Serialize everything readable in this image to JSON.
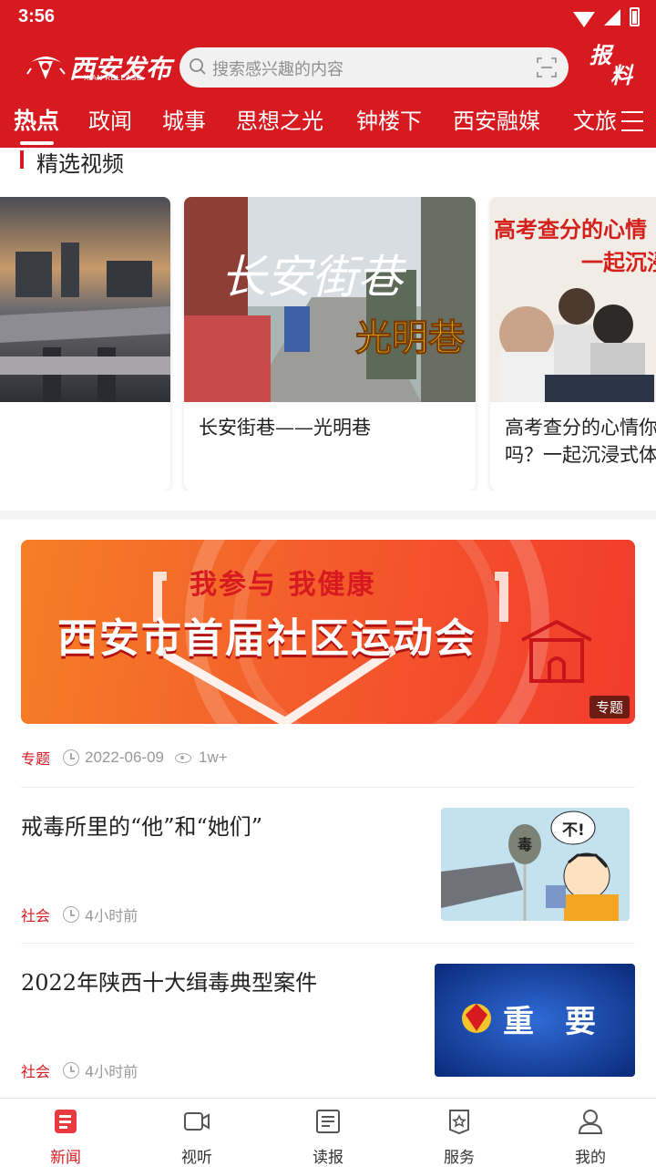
{
  "status_bar": {
    "time": "3:56"
  },
  "header": {
    "logo_text": "西安发布",
    "logo_sub": "XIAN RELEASE",
    "search_placeholder": "搜索感兴趣的内容",
    "report_label_1": "报",
    "report_label_2": "料"
  },
  "tabs": [
    {
      "label": "热点",
      "active": true
    },
    {
      "label": "政闻"
    },
    {
      "label": "城事"
    },
    {
      "label": "思想之光"
    },
    {
      "label": "钟楼下"
    },
    {
      "label": "西安融媒"
    },
    {
      "label": "文旅"
    }
  ],
  "section": {
    "title": "精选视频"
  },
  "videos": [
    {
      "title": ""
    },
    {
      "title": "长安街巷——光明巷",
      "thumb_text_1": "长安街巷",
      "thumb_text_2": "光明巷"
    },
    {
      "title_line1": "高考查分的心情你",
      "title_line2": "吗？一起沉浸式体",
      "thumb_text_1": "高考查分的心情",
      "thumb_text_2": "一起沉浸"
    }
  ],
  "banner": {
    "top_text": "我参与 我健康",
    "main_text": "西安市首届社区运动会",
    "tag": "专题",
    "meta": {
      "category": "专题",
      "date": "2022-06-09",
      "views": "1w+"
    }
  },
  "news": [
    {
      "title": "戒毒所里的“他”和“她们”",
      "category": "社会",
      "time": "4小时前",
      "thumb_bubble": "不!",
      "thumb_bag": "毒"
    },
    {
      "title": "2022年陕西十大缉毒典型案件",
      "category": "社会",
      "time": "4小时前",
      "thumb_text": "重　要"
    }
  ],
  "tabbar": [
    {
      "label": "新闻",
      "icon": "news-icon",
      "active": true
    },
    {
      "label": "视听",
      "icon": "video-icon"
    },
    {
      "label": "读报",
      "icon": "newspaper-icon"
    },
    {
      "label": "服务",
      "icon": "service-icon"
    },
    {
      "label": "我的",
      "icon": "profile-icon"
    }
  ],
  "colors": {
    "brand": "#d71920"
  }
}
